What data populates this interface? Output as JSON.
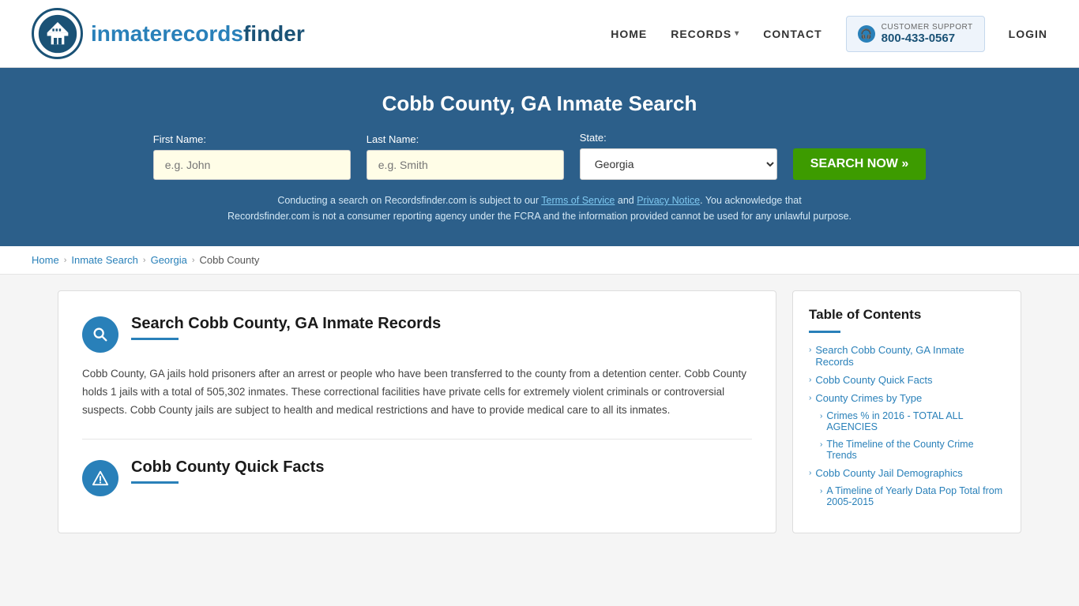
{
  "header": {
    "logo_text_main": "inmaterecords",
    "logo_text_bold": "finder",
    "nav": {
      "home": "HOME",
      "records": "RECORDS",
      "contact": "CONTACT",
      "login": "LOGIN"
    },
    "support": {
      "label": "CUSTOMER SUPPORT",
      "number": "800-433-0567"
    }
  },
  "hero": {
    "title": "Cobb County, GA Inmate Search",
    "first_name_label": "First Name:",
    "first_name_placeholder": "e.g. John",
    "last_name_label": "Last Name:",
    "last_name_placeholder": "e.g. Smith",
    "state_label": "State:",
    "state_value": "Georgia",
    "search_button": "SEARCH NOW »",
    "disclaimer": "Conducting a search on Recordsfinder.com is subject to our Terms of Service and Privacy Notice. You acknowledge that Recordsfinder.com is not a consumer reporting agency under the FCRA and the information provided cannot be used for any unlawful purpose.",
    "tos_link": "Terms of Service",
    "privacy_link": "Privacy Notice"
  },
  "breadcrumb": {
    "home": "Home",
    "inmate_search": "Inmate Search",
    "georgia": "Georgia",
    "current": "Cobb County"
  },
  "main_section": {
    "title": "Search Cobb County, GA Inmate Records",
    "text": "Cobb County, GA jails hold prisoners after an arrest or people who have been transferred to the county from a detention center. Cobb County holds 1 jails with a total of 505,302 inmates. These correctional facilities have private cells for extremely violent criminals or controversial suspects. Cobb County jails are subject to health and medical restrictions and have to provide medical care to all its inmates."
  },
  "quick_facts_section": {
    "title": "Cobb County Quick Facts"
  },
  "toc": {
    "title": "Table of Contents",
    "items": [
      {
        "label": "Search Cobb County, GA Inmate Records",
        "indent": 0
      },
      {
        "label": "Cobb County Quick Facts",
        "indent": 0
      },
      {
        "label": "County Crimes by Type",
        "indent": 0
      },
      {
        "label": "Crimes % in 2016 - TOTAL ALL AGENCIES",
        "indent": 1
      },
      {
        "label": "The Timeline of the County Crime Trends",
        "indent": 1
      },
      {
        "label": "Cobb County Jail Demographics",
        "indent": 0
      },
      {
        "label": "A Timeline of Yearly Data Pop Total from 2005-2015",
        "indent": 1
      }
    ]
  }
}
